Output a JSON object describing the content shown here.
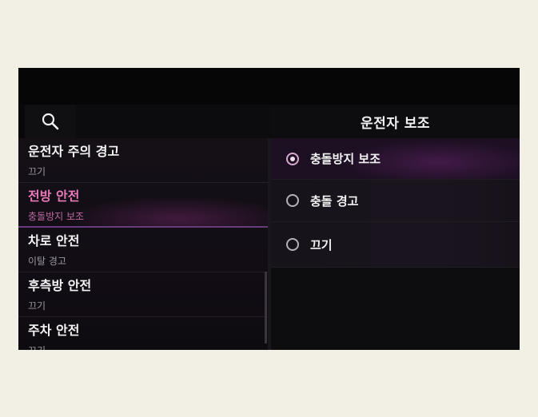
{
  "header": {
    "search_icon": "search-icon",
    "title": "운전자 보조"
  },
  "menu": [
    {
      "title": "운전자 주의 경고",
      "subtitle": "끄기",
      "active": false
    },
    {
      "title": "전방 안전",
      "subtitle": "충돌방지 보조",
      "active": true
    },
    {
      "title": "차로 안전",
      "subtitle": "이탈 경고",
      "active": false
    },
    {
      "title": "후측방 안전",
      "subtitle": "끄기",
      "active": false
    },
    {
      "title": "주차 안전",
      "subtitle": "끄기",
      "active": false
    }
  ],
  "options": [
    {
      "label": "충돌방지 보조",
      "selected": true
    },
    {
      "label": "충돌 경고",
      "selected": false
    },
    {
      "label": "끄기",
      "selected": false
    }
  ],
  "colors": {
    "accent": "#e879b8",
    "background": "#080709",
    "page": "#f2efe4"
  }
}
